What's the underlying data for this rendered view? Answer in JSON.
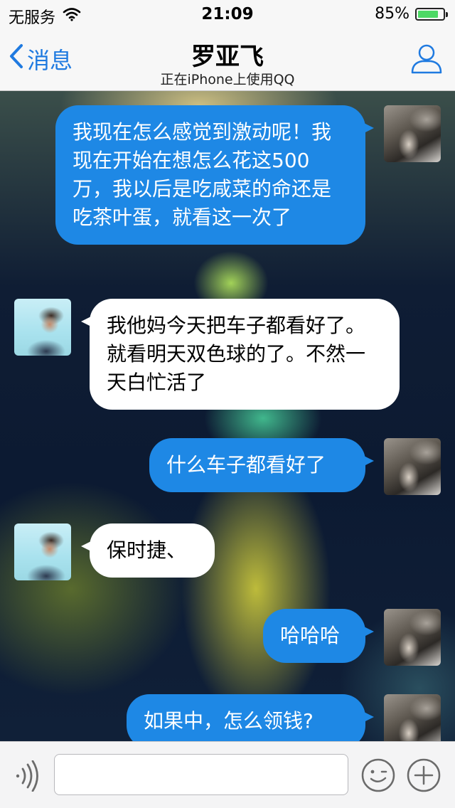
{
  "status_bar": {
    "carrier": "无服务",
    "time": "21:09",
    "battery_percent_text": "85%",
    "battery_level": 0.85
  },
  "nav": {
    "back_label": "消息",
    "title": "罗亚飞",
    "subtitle": "正在iPhone上使用QQ"
  },
  "messages": [
    {
      "direction": "outgoing",
      "text": "我现在怎么感觉到激动呢！我现在开始在想怎么花这500万，我以后是吃咸菜的命还是吃茶叶蛋，就看这一次了"
    },
    {
      "direction": "incoming",
      "text": "我他妈今天把车子都看好了。就看明天双色球的了。不然一天白忙活了"
    },
    {
      "direction": "outgoing",
      "text": "什么车子都看好了"
    },
    {
      "direction": "incoming",
      "text": "保时捷、"
    },
    {
      "direction": "outgoing",
      "text": "哈哈哈"
    },
    {
      "direction": "outgoing",
      "text": "如果中，怎么领钱?"
    }
  ],
  "input": {
    "placeholder": ""
  },
  "colors": {
    "accent": "#1f7ae0",
    "outgoing_bubble": "#1e88e5",
    "incoming_bubble": "#ffffff",
    "battery": "#4cd964"
  },
  "icons": {
    "wifi": "wifi-icon",
    "back": "chevron-left-icon",
    "profile": "person-icon",
    "voice": "voice-icon",
    "emoji": "emoji-icon",
    "plus": "plus-icon"
  }
}
